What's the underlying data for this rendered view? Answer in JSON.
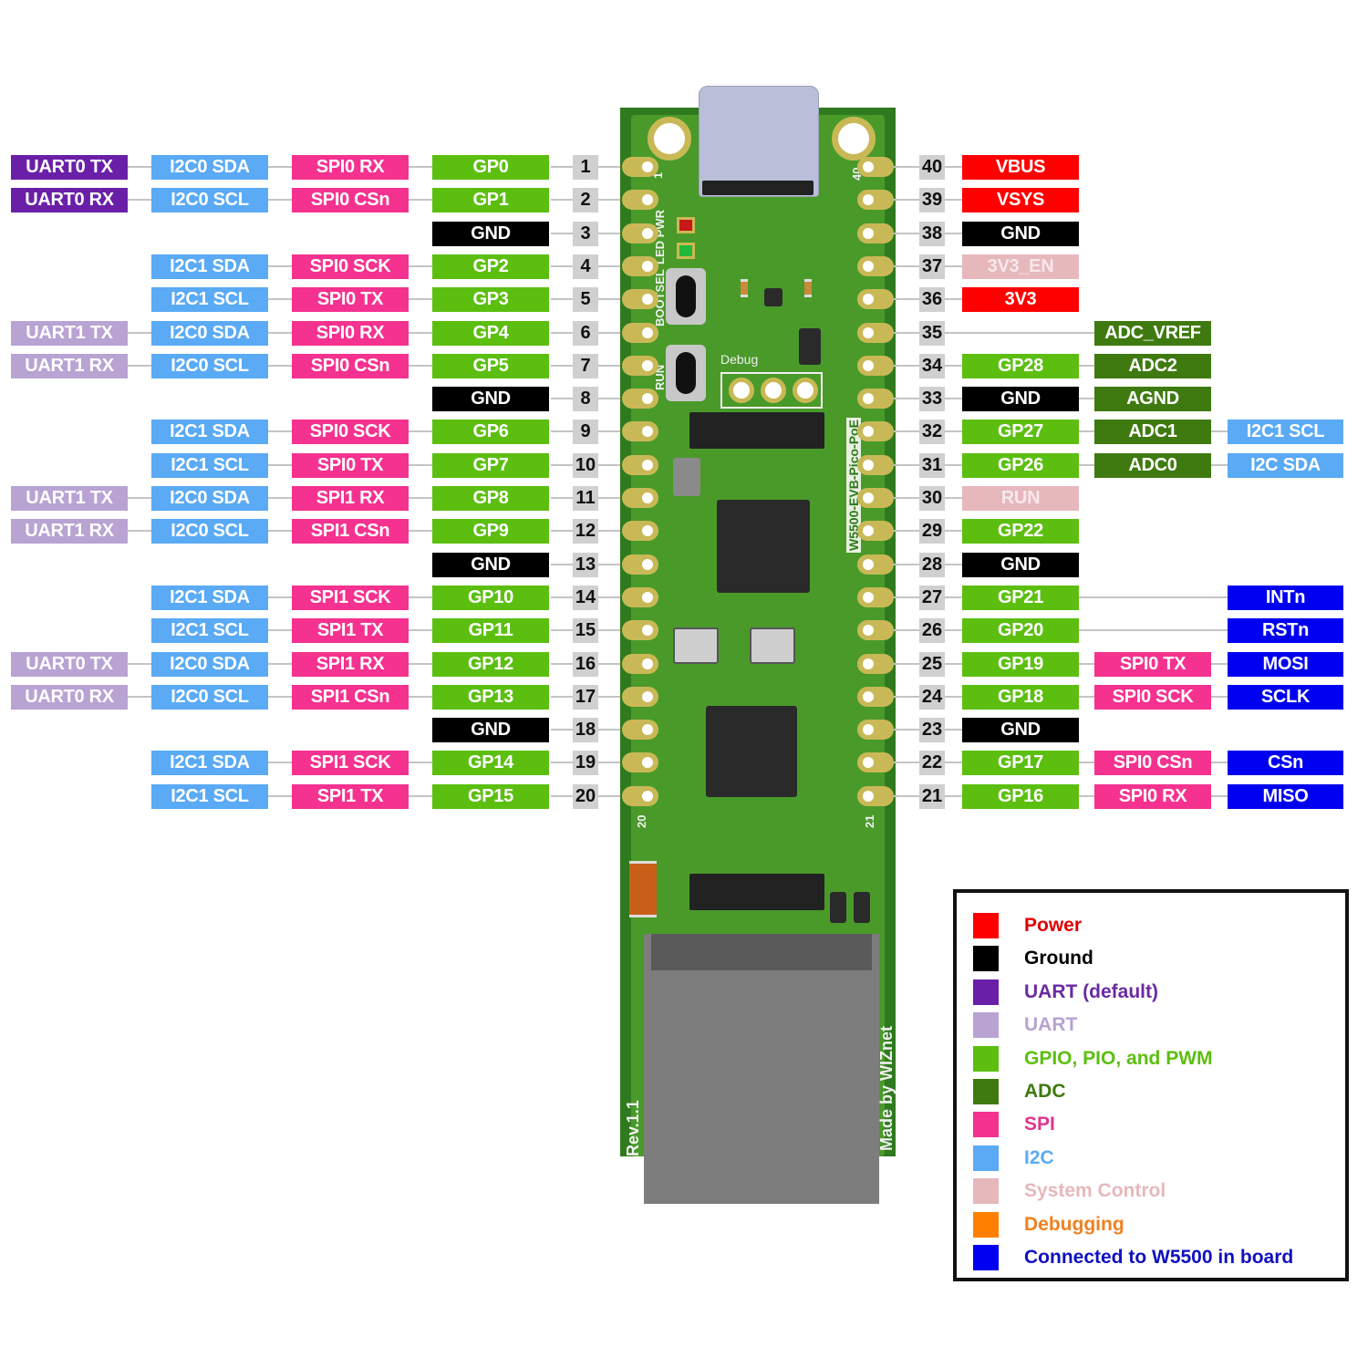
{
  "colors": {
    "power": "#ff0000",
    "ground": "#000000",
    "uart_default": "#6a1fa8",
    "uart": "#b8a3d3",
    "gpio": "#5cbf10",
    "adc": "#3f7a10",
    "spi": "#f5328f",
    "i2c": "#5aaaf5",
    "system": "#e6b8bc",
    "debug": "#ff8000",
    "w5500": "#0000f0"
  },
  "board": {
    "name": "W5500-EVB-Pico-PoE",
    "revision": "Rev.1.1",
    "maker": "Made by WIZnet",
    "silk_led": "LED",
    "silk_pwr": "PWR",
    "silk_bootsel": "BOOTSEL",
    "silk_run": "RUN",
    "silk_debug": "Debug",
    "silk_pin1": "1",
    "silk_pin40": "40",
    "silk_pin20": "20",
    "silk_pin21": "21"
  },
  "left_pins": [
    {
      "pin": "1",
      "gp": "GP0",
      "gp_type": "gpio",
      "spi": "SPI0 RX",
      "i2c": "I2C0 SDA",
      "uart": "UART0 TX",
      "uart_type": "uart_default"
    },
    {
      "pin": "2",
      "gp": "GP1",
      "gp_type": "gpio",
      "spi": "SPI0 CSn",
      "i2c": "I2C0 SCL",
      "uart": "UART0 RX",
      "uart_type": "uart_default"
    },
    {
      "pin": "3",
      "gp": "GND",
      "gp_type": "ground"
    },
    {
      "pin": "4",
      "gp": "GP2",
      "gp_type": "gpio",
      "spi": "SPI0 SCK",
      "i2c": "I2C1 SDA"
    },
    {
      "pin": "5",
      "gp": "GP3",
      "gp_type": "gpio",
      "spi": "SPI0 TX",
      "i2c": "I2C1 SCL"
    },
    {
      "pin": "6",
      "gp": "GP4",
      "gp_type": "gpio",
      "spi": "SPI0 RX",
      "i2c": "I2C0 SDA",
      "uart": "UART1 TX",
      "uart_type": "uart"
    },
    {
      "pin": "7",
      "gp": "GP5",
      "gp_type": "gpio",
      "spi": "SPI0 CSn",
      "i2c": "I2C0 SCL",
      "uart": "UART1 RX",
      "uart_type": "uart"
    },
    {
      "pin": "8",
      "gp": "GND",
      "gp_type": "ground"
    },
    {
      "pin": "9",
      "gp": "GP6",
      "gp_type": "gpio",
      "spi": "SPI0 SCK",
      "i2c": "I2C1 SDA"
    },
    {
      "pin": "10",
      "gp": "GP7",
      "gp_type": "gpio",
      "spi": "SPI0 TX",
      "i2c": "I2C1 SCL"
    },
    {
      "pin": "11",
      "gp": "GP8",
      "gp_type": "gpio",
      "spi": "SPI1 RX",
      "i2c": "I2C0 SDA",
      "uart": "UART1 TX",
      "uart_type": "uart"
    },
    {
      "pin": "12",
      "gp": "GP9",
      "gp_type": "gpio",
      "spi": "SPI1 CSn",
      "i2c": "I2C0 SCL",
      "uart": "UART1 RX",
      "uart_type": "uart"
    },
    {
      "pin": "13",
      "gp": "GND",
      "gp_type": "ground"
    },
    {
      "pin": "14",
      "gp": "GP10",
      "gp_type": "gpio",
      "spi": "SPI1 SCK",
      "i2c": "I2C1 SDA"
    },
    {
      "pin": "15",
      "gp": "GP11",
      "gp_type": "gpio",
      "spi": "SPI1 TX",
      "i2c": "I2C1 SCL"
    },
    {
      "pin": "16",
      "gp": "GP12",
      "gp_type": "gpio",
      "spi": "SPI1 RX",
      "i2c": "I2C0 SDA",
      "uart": "UART0 TX",
      "uart_type": "uart"
    },
    {
      "pin": "17",
      "gp": "GP13",
      "gp_type": "gpio",
      "spi": "SPI1 CSn",
      "i2c": "I2C0 SCL",
      "uart": "UART0 RX",
      "uart_type": "uart"
    },
    {
      "pin": "18",
      "gp": "GND",
      "gp_type": "ground"
    },
    {
      "pin": "19",
      "gp": "GP14",
      "gp_type": "gpio",
      "spi": "SPI1 SCK",
      "i2c": "I2C1 SDA"
    },
    {
      "pin": "20",
      "gp": "GP15",
      "gp_type": "gpio",
      "spi": "SPI1 TX",
      "i2c": "I2C1 SCL"
    }
  ],
  "right_pins": [
    {
      "pin": "40",
      "main": "VBUS",
      "main_type": "power"
    },
    {
      "pin": "39",
      "main": "VSYS",
      "main_type": "power"
    },
    {
      "pin": "38",
      "main": "GND",
      "main_type": "ground"
    },
    {
      "pin": "37",
      "main": "3V3_EN",
      "main_type": "system"
    },
    {
      "pin": "36",
      "main": "3V3",
      "main_type": "power"
    },
    {
      "pin": "35",
      "alt": "ADC_VREF",
      "alt_type": "adc"
    },
    {
      "pin": "34",
      "main": "GP28",
      "main_type": "gpio",
      "alt": "ADC2",
      "alt_type": "adc"
    },
    {
      "pin": "33",
      "main": "GND",
      "main_type": "ground",
      "alt": "AGND",
      "alt_type": "adc"
    },
    {
      "pin": "32",
      "main": "GP27",
      "main_type": "gpio",
      "alt": "ADC1",
      "alt_type": "adc",
      "ext": "I2C1 SCL",
      "ext_type": "i2c"
    },
    {
      "pin": "31",
      "main": "GP26",
      "main_type": "gpio",
      "alt": "ADC0",
      "alt_type": "adc",
      "ext": "I2C SDA",
      "ext_type": "i2c"
    },
    {
      "pin": "30",
      "main": "RUN",
      "main_type": "system"
    },
    {
      "pin": "29",
      "main": "GP22",
      "main_type": "gpio"
    },
    {
      "pin": "28",
      "main": "GND",
      "main_type": "ground"
    },
    {
      "pin": "27",
      "main": "GP21",
      "main_type": "gpio",
      "ext": "INTn",
      "ext_type": "w5500"
    },
    {
      "pin": "26",
      "main": "GP20",
      "main_type": "gpio",
      "ext": "RSTn",
      "ext_type": "w5500"
    },
    {
      "pin": "25",
      "main": "GP19",
      "main_type": "gpio",
      "alt": "SPI0 TX",
      "alt_type": "spi",
      "ext": "MOSI",
      "ext_type": "w5500"
    },
    {
      "pin": "24",
      "main": "GP18",
      "main_type": "gpio",
      "alt": "SPI0 SCK",
      "alt_type": "spi",
      "ext": "SCLK",
      "ext_type": "w5500"
    },
    {
      "pin": "23",
      "main": "GND",
      "main_type": "ground"
    },
    {
      "pin": "22",
      "main": "GP17",
      "main_type": "gpio",
      "alt": "SPI0 CSn",
      "alt_type": "spi",
      "ext": "CSn",
      "ext_type": "w5500"
    },
    {
      "pin": "21",
      "main": "GP16",
      "main_type": "gpio",
      "alt": "SPI0 RX",
      "alt_type": "spi",
      "ext": "MISO",
      "ext_type": "w5500"
    }
  ],
  "legend": [
    {
      "label": "Power",
      "type": "power",
      "text_color": "#e00000"
    },
    {
      "label": "Ground",
      "type": "ground",
      "text_color": "#000000"
    },
    {
      "label": "UART  (default)",
      "type": "uart_default",
      "text_color": "#6a2aa0"
    },
    {
      "label": "UART",
      "type": "uart",
      "text_color": "#b8a3d3"
    },
    {
      "label": "GPIO, PIO, and PWM",
      "type": "gpio",
      "text_color": "#5cbf10"
    },
    {
      "label": "ADC",
      "type": "adc",
      "text_color": "#3f7a10"
    },
    {
      "label": "SPI",
      "type": "spi",
      "text_color": "#e0348e"
    },
    {
      "label": "I2C",
      "type": "i2c",
      "text_color": "#5aaaf5"
    },
    {
      "label": "System Control",
      "type": "system",
      "text_color": "#e6b8bc"
    },
    {
      "label": "Debugging",
      "type": "debug",
      "text_color": "#f08020"
    },
    {
      "label": "Connected to W5500 in board",
      "type": "w5500",
      "text_color": "#1010c0"
    }
  ]
}
